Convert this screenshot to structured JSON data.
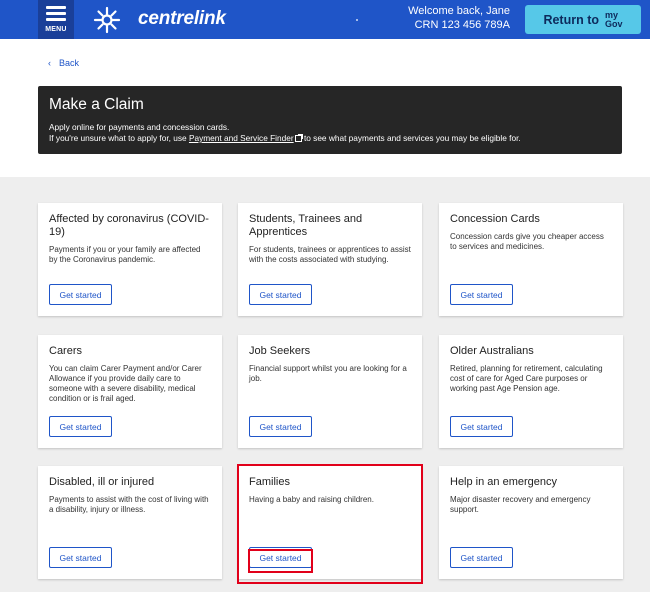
{
  "header": {
    "menu_label": "MENU",
    "brand": "centrelink",
    "welcome_line1": "Welcome back, Jane",
    "welcome_line2": "CRN 123 456 789A",
    "return_label": "Return to",
    "mygov_line1": "my",
    "mygov_line2": "Gov"
  },
  "back_label": "Back",
  "banner": {
    "title": "Make a Claim",
    "line1": "Apply online for payments and concession cards.",
    "line2_prefix": "If you're unsure what to apply for, use ",
    "line2_link": "Payment and Service Finder",
    "line2_suffix": " to see what payments and services you may be eligible for."
  },
  "cards": [
    {
      "title": "Affected by coronavirus (COVID-19)",
      "desc": "Payments if you or your family are affected by the Coronavirus pandemic.",
      "button": "Get started"
    },
    {
      "title": "Students, Trainees and Apprentices",
      "desc": "For students, trainees or apprentices to assist with the costs associated with studying.",
      "button": "Get started"
    },
    {
      "title": "Concession Cards",
      "desc": "Concession cards give you cheaper access to services and medicines.",
      "button": "Get started"
    },
    {
      "title": "Carers",
      "desc": "You can claim Carer Payment and/or Carer Allowance if you provide daily care to someone with a severe disability, medical condition or is frail aged.",
      "button": "Get started"
    },
    {
      "title": "Job Seekers",
      "desc": "Financial support whilst you are looking for a job.",
      "button": "Get started"
    },
    {
      "title": "Older Australians",
      "desc": "Retired, planning for retirement, calculating cost of care for Aged Care purposes or working past Age Pension age.",
      "button": "Get started"
    },
    {
      "title": "Disabled, ill or injured",
      "desc": "Payments to assist with the cost of living with a disability, injury or illness.",
      "button": "Get started"
    },
    {
      "title": "Families",
      "desc": "Having a baby and raising children.",
      "button": "Get started"
    },
    {
      "title": "Help in an emergency",
      "desc": "Major disaster recovery and emergency support.",
      "button": "Get started"
    }
  ],
  "colors": {
    "header_bg": "#1f55c8",
    "return_bg": "#56c8e8",
    "banner_bg": "#262626",
    "highlight": "#e1001a"
  }
}
